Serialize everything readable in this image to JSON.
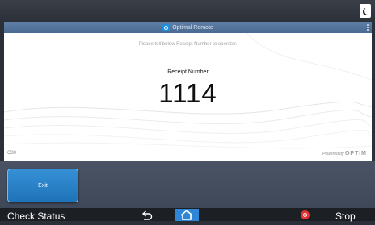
{
  "app": {
    "title": "Optimal Remote",
    "icon": "optimal-remote-app-icon"
  },
  "top_bar": {
    "night_mode_icon": "crescent-moon-icon"
  },
  "main": {
    "instruction": "Please tell below Receipt Number to operator.",
    "receipt_label": "Receipt Number",
    "receipt_number": "1114",
    "device_id": "C30",
    "powered_by": "Powered by",
    "brand": "OPTiM"
  },
  "actions": {
    "exit_label": "Exit"
  },
  "nav": {
    "check_status_label": "Check Status",
    "back_icon": "back-arrow-icon",
    "home_icon": "home-icon",
    "stop_icon": "stop-icon",
    "stop_label": "Stop"
  },
  "colors": {
    "accent": "#2f86d6",
    "title_bar": "#5a7ba3",
    "exit_button": "#2a83cc",
    "stop": "#e53333",
    "nav_background": "#1c1f24"
  }
}
